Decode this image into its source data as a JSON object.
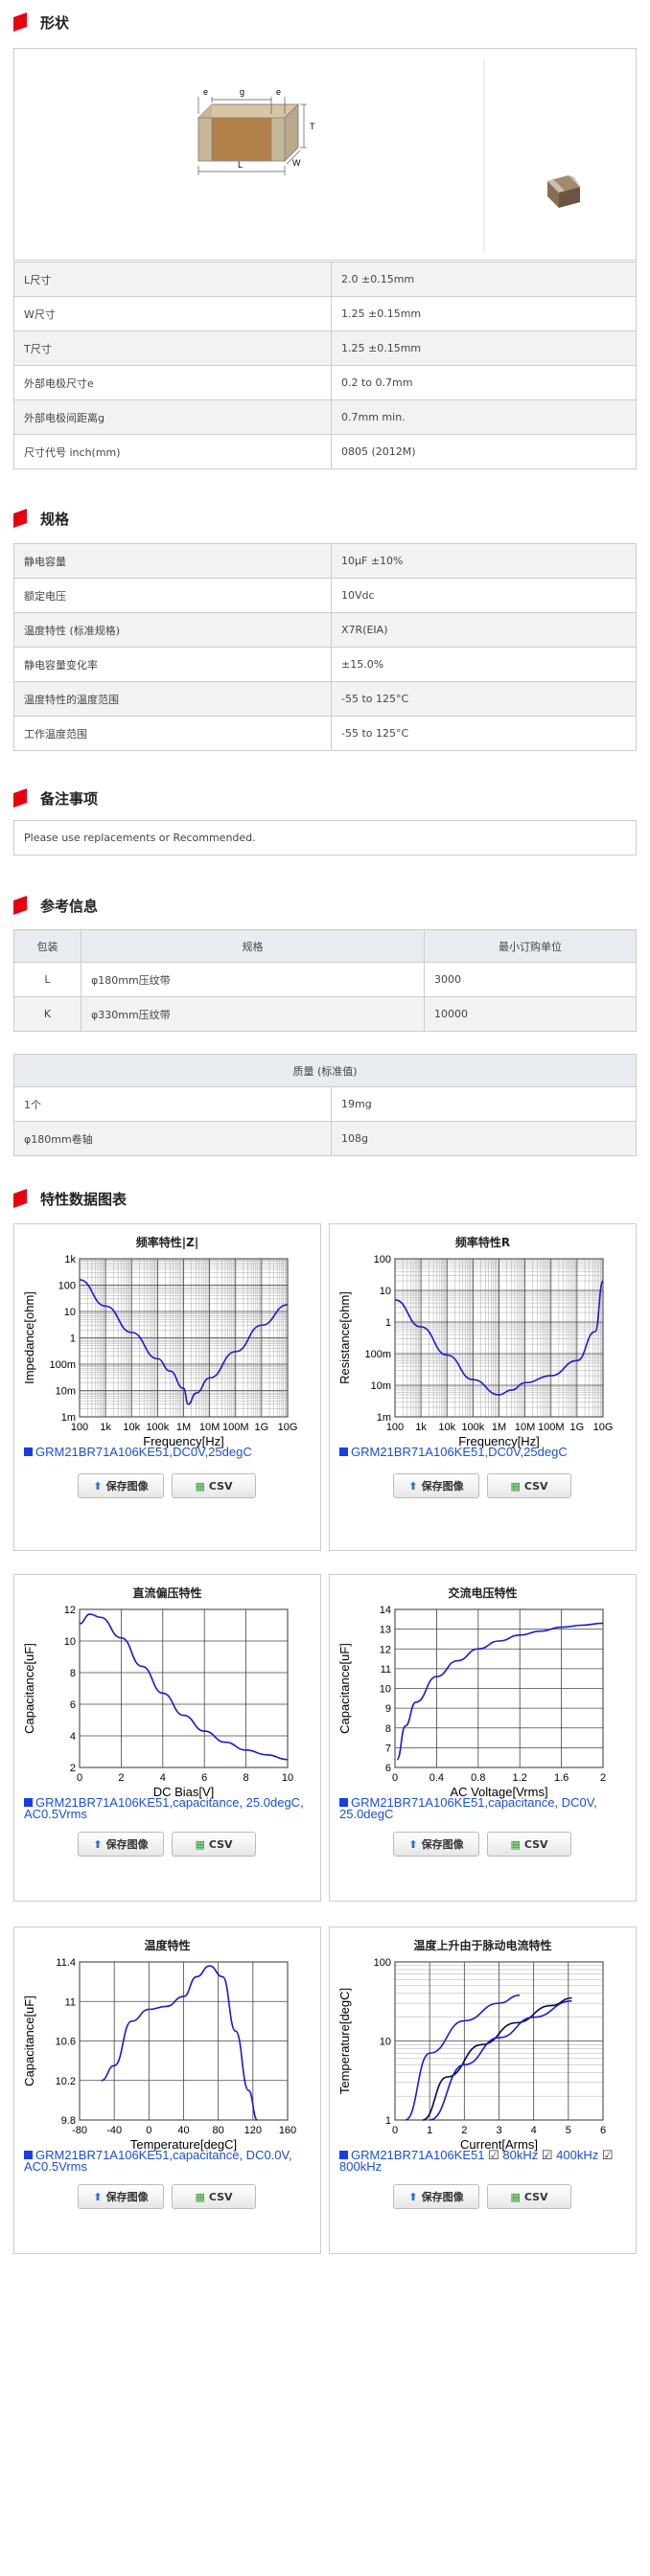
{
  "sections": {
    "shape": "形状",
    "spec": "规格",
    "notes": "备注事项",
    "ref": "参考信息",
    "charts": "特性数据图表"
  },
  "dims": {
    "e": "e",
    "g": "g",
    "T": "T",
    "L": "L",
    "W": "W"
  },
  "shape_rows": [
    {
      "k": "L尺寸",
      "v": "2.0 ±0.15mm"
    },
    {
      "k": "W尺寸",
      "v": "1.25 ±0.15mm"
    },
    {
      "k": "T尺寸",
      "v": "1.25 ±0.15mm"
    },
    {
      "k": "外部电极尺寸e",
      "v": "0.2 to 0.7mm"
    },
    {
      "k": "外部电极间距离g",
      "v": "0.7mm min."
    },
    {
      "k": "尺寸代号 inch(mm)",
      "v": "0805 (2012M)"
    }
  ],
  "spec_rows": [
    {
      "k": "静电容量",
      "v": "10μF ±10%"
    },
    {
      "k": "额定电压",
      "v": "10Vdc"
    },
    {
      "k": "温度特性 (标准规格)",
      "v": "X7R(EIA)"
    },
    {
      "k": "静电容量变化率",
      "v": "±15.0%"
    },
    {
      "k": "温度特性的温度范围",
      "v": "-55 to 125°C"
    },
    {
      "k": "工作温度范围",
      "v": "-55 to 125°C"
    }
  ],
  "note": "Please use replacements or Recommended.",
  "pack": {
    "headers": [
      "包装",
      "规格",
      "最小订购单位"
    ],
    "rows": [
      [
        "L",
        "φ180mm压纹带",
        "3000"
      ],
      [
        "K",
        "φ330mm压纹带",
        "10000"
      ]
    ]
  },
  "mass": {
    "header": "质量 (标准值)",
    "rows": [
      [
        "1个",
        "19mg"
      ],
      [
        "φ180mm卷轴",
        "108g"
      ]
    ]
  },
  "buttons": {
    "save": "保存图像",
    "csv": "CSV"
  },
  "chart_data": [
    {
      "type": "line",
      "title": "频率特性|Z|",
      "xlabel": "Frequency[Hz]",
      "ylabel": "Impedance[ohm]",
      "xticks": [
        "100",
        "1k",
        "10k",
        "100k",
        "1M",
        "10M",
        "100M",
        "1G",
        "10G"
      ],
      "yticks": [
        "1m",
        "10m",
        "100m",
        "1",
        "10",
        "100",
        "1k"
      ],
      "log_x": true,
      "log_y": true,
      "series": [
        {
          "name": "GRM21BR71A106KE51,DC0V,25degC",
          "x": [
            100,
            1000,
            10000,
            100000,
            300000,
            1000000,
            1500000,
            3000000,
            10000000,
            100000000,
            1000000000,
            10000000000
          ],
          "y": [
            160,
            16,
            1.6,
            0.16,
            0.055,
            0.012,
            0.003,
            0.008,
            0.03,
            0.3,
            3,
            18
          ]
        }
      ]
    },
    {
      "type": "line",
      "title": "频率特性R",
      "xlabel": "Frequency[Hz]",
      "ylabel": "Resistance[ohm]",
      "xticks": [
        "100",
        "1k",
        "10k",
        "100k",
        "1M",
        "10M",
        "100M",
        "1G",
        "10G"
      ],
      "yticks": [
        "1m",
        "10m",
        "100m",
        "1",
        "10",
        "100"
      ],
      "log_x": true,
      "log_y": true,
      "series": [
        {
          "name": "GRM21BR71A106KE51,DC0V,25degC",
          "x": [
            100,
            1000,
            10000,
            100000,
            1000000,
            3000000,
            10000000,
            100000000,
            1000000000,
            5000000000,
            10000000000
          ],
          "y": [
            5,
            0.7,
            0.09,
            0.015,
            0.005,
            0.007,
            0.012,
            0.02,
            0.06,
            0.5,
            20
          ]
        }
      ]
    },
    {
      "type": "line",
      "title": "直流偏压特性",
      "xlabel": "DC Bias[V]",
      "ylabel": "Capacitance[uF]",
      "xlim": [
        0,
        10
      ],
      "ylim": [
        2,
        12
      ],
      "xticks": [
        "0",
        "2",
        "4",
        "6",
        "8",
        "10"
      ],
      "yticks": [
        "2",
        "4",
        "6",
        "8",
        "10",
        "12"
      ],
      "series": [
        {
          "name": "GRM21BR71A106KE51,capacitance, 25.0degC, AC0.5Vrms",
          "x": [
            0,
            0.5,
            1,
            2,
            3,
            4,
            5,
            6,
            7,
            8,
            9,
            10
          ],
          "y": [
            11.1,
            11.7,
            11.5,
            10.2,
            8.4,
            6.7,
            5.3,
            4.3,
            3.6,
            3.1,
            2.8,
            2.5
          ]
        }
      ]
    },
    {
      "type": "line",
      "title": "交流电压特性",
      "xlabel": "AC Voltage[Vrms]",
      "ylabel": "Capacitance[uF]",
      "xlim": [
        0,
        2
      ],
      "ylim": [
        6,
        14
      ],
      "xticks": [
        "0",
        "0.4",
        "0.8",
        "1.2",
        "1.6",
        "2"
      ],
      "yticks": [
        "6",
        "7",
        "8",
        "9",
        "10",
        "11",
        "12",
        "13",
        "14"
      ],
      "series": [
        {
          "name": "GRM21BR71A106KE51,capacitance, DC0V, 25.0degC",
          "x": [
            0.02,
            0.1,
            0.2,
            0.4,
            0.6,
            0.8,
            1.0,
            1.2,
            1.4,
            1.6,
            1.8,
            2.0
          ],
          "y": [
            6.4,
            8.1,
            9.3,
            10.6,
            11.4,
            12.0,
            12.4,
            12.7,
            12.9,
            13.1,
            13.2,
            13.3
          ]
        }
      ]
    },
    {
      "type": "line",
      "title": "温度特性",
      "xlabel": "Temperature[degC]",
      "ylabel": "Capacitance[uF]",
      "xlim": [
        -80,
        160
      ],
      "ylim": [
        9.8,
        11.4
      ],
      "xticks": [
        "-80",
        "-40",
        "0",
        "40",
        "80",
        "120",
        "160"
      ],
      "yticks": [
        "9.8",
        "10.2",
        "10.6",
        "11",
        "11.4"
      ],
      "series": [
        {
          "name": "GRM21BR71A106KE51,capacitance, DC0.0V, AC0.5Vrms",
          "x": [
            -55,
            -40,
            -20,
            0,
            20,
            40,
            55,
            70,
            85,
            100,
            115,
            125
          ],
          "y": [
            10.2,
            10.35,
            10.8,
            10.92,
            10.95,
            11.05,
            11.25,
            11.36,
            11.25,
            10.7,
            10.1,
            9.8
          ]
        }
      ]
    },
    {
      "type": "line",
      "title": "温度上升由于脉动电流特性",
      "xlabel": "Current[Arms]",
      "ylabel": "Temperature[degC]",
      "xlim": [
        0,
        6
      ],
      "xticks": [
        "0",
        "1",
        "2",
        "3",
        "4",
        "5",
        "6"
      ],
      "yticks": [
        "1",
        "10",
        "100"
      ],
      "log_y": true,
      "series": [
        {
          "name": "80kHz",
          "x": [
            0.3,
            1,
            2,
            3,
            3.6
          ],
          "y": [
            1,
            7,
            18,
            30,
            38
          ]
        },
        {
          "name": "400kHz",
          "x": [
            0.8,
            1.5,
            2.5,
            3.5,
            4.5,
            5.1
          ],
          "y": [
            1,
            3.5,
            9,
            17,
            28,
            35
          ]
        },
        {
          "name": "800kHz",
          "x": [
            1,
            2,
            3,
            4,
            5.1
          ],
          "y": [
            1,
            5,
            11,
            20,
            32
          ]
        }
      ],
      "caption": "GRM21BR71A106KE51"
    }
  ]
}
